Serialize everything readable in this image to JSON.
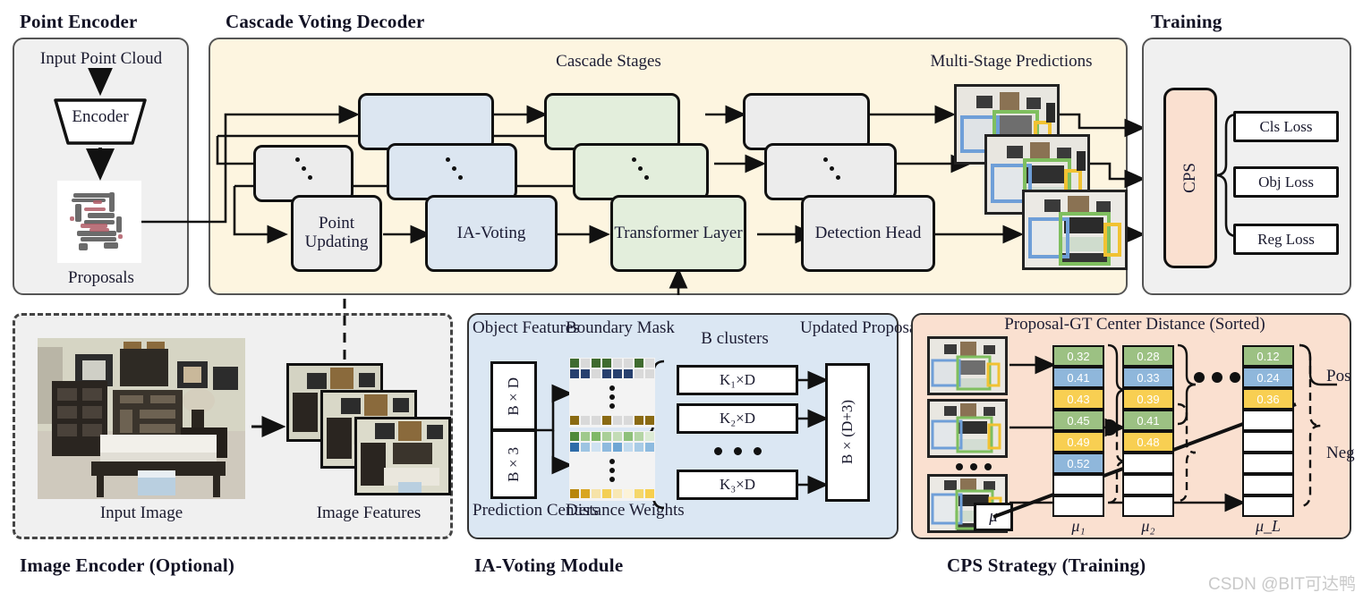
{
  "headers": {
    "point_encoder": "Point Encoder",
    "cascade_decoder": "Cascade Voting Decoder",
    "training": "Training",
    "image_encoder": "Image Encoder (Optional)",
    "ia_voting_module": "IA-Voting Module",
    "cps_strategy": "CPS Strategy (Training)"
  },
  "point_encoder": {
    "input_label": "Input Point Cloud",
    "encoder_label": "Encoder",
    "proposals_label": "Proposals"
  },
  "decoder": {
    "cascade_stages_title": "Cascade Stages",
    "multi_stage_title": "Multi-Stage Predictions",
    "stages": [
      {
        "label": "Point Updating",
        "color": "#ececec"
      },
      {
        "label": "IA-Voting",
        "color": "#dce6f1"
      },
      {
        "label": "Transformer Layer",
        "color": "#e3eedc"
      },
      {
        "label": "Detection Head",
        "color": "#ececec"
      }
    ]
  },
  "training": {
    "cps_label": "CPS",
    "losses": [
      "Cls Loss",
      "Obj Loss",
      "Reg Loss"
    ]
  },
  "image_encoder": {
    "input_image_label": "Input Image",
    "image_features_label": "Image Features"
  },
  "ia_voting": {
    "object_features_label": "Object Features",
    "boundary_mask_label": "Boundary Mask",
    "b_clusters_label": "B clusters",
    "updated_proposals_label": "Updated Proposals",
    "prediction_centers_label": "Prediction Centers",
    "distance_weights_label": "Distance Weights",
    "feat_dim_label": "B×D",
    "center_dim_label": "B×3",
    "clusters": [
      "K₁×D",
      "K₂×D",
      "K₃×D"
    ],
    "output_dim_label": "B×(D+3)"
  },
  "cps": {
    "title": "Proposal-GT Center Distance (Sorted)",
    "mu_symbol": "μ",
    "pos_label": "Pos",
    "neg_label": "Neg",
    "columns": [
      {
        "name": "μ₁",
        "cells": [
          {
            "value": "0.32",
            "color": "#9cc183"
          },
          {
            "value": "0.41",
            "color": "#8fb7db"
          },
          {
            "value": "0.43",
            "color": "#f8cf52"
          },
          {
            "value": "0.45",
            "color": "#9cc183"
          },
          {
            "value": "0.49",
            "color": "#f8cf52"
          },
          {
            "value": "0.52",
            "color": "#8fb7db"
          },
          {
            "value": "",
            "color": "#ffffff"
          },
          {
            "value": "",
            "color": "#ffffff"
          }
        ]
      },
      {
        "name": "μ₂",
        "cells": [
          {
            "value": "0.28",
            "color": "#9cc183"
          },
          {
            "value": "0.33",
            "color": "#8fb7db"
          },
          {
            "value": "0.39",
            "color": "#f8cf52"
          },
          {
            "value": "0.41",
            "color": "#9cc183"
          },
          {
            "value": "0.48",
            "color": "#f8cf52"
          },
          {
            "value": "",
            "color": "#ffffff"
          },
          {
            "value": "",
            "color": "#ffffff"
          },
          {
            "value": "",
            "color": "#ffffff"
          }
        ]
      },
      {
        "name": "μ_L",
        "cells": [
          {
            "value": "0.12",
            "color": "#9cc183"
          },
          {
            "value": "0.24",
            "color": "#8fb7db"
          },
          {
            "value": "0.36",
            "color": "#f8cf52"
          },
          {
            "value": "",
            "color": "#ffffff"
          },
          {
            "value": "",
            "color": "#ffffff"
          },
          {
            "value": "",
            "color": "#ffffff"
          },
          {
            "value": "",
            "color": "#ffffff"
          },
          {
            "value": "",
            "color": "#ffffff"
          }
        ]
      }
    ]
  },
  "watermark": "CSDN @BIT可达鸭",
  "colors": {
    "cream": "#fdf5e0",
    "blue": "#dce6f1",
    "green": "#e3eedc",
    "grey": "#ececec",
    "peach": "#fae0d0",
    "panel_grey": "#f0f0f0",
    "ia_bg": "#dbe7f3"
  }
}
